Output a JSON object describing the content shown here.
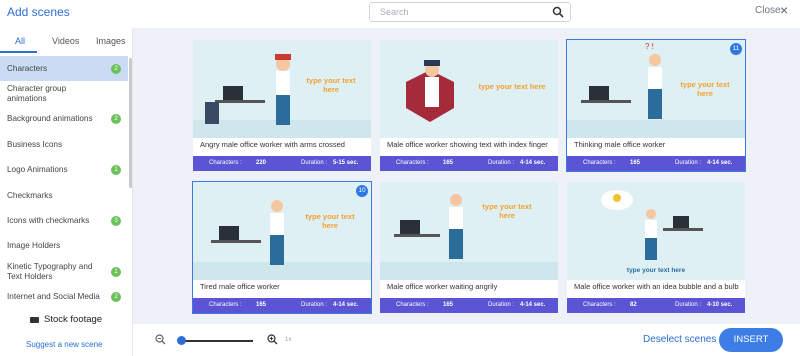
{
  "header": {
    "title": "Add scenes",
    "search_placeholder": "Search",
    "close_label": "Close",
    "close_glyph": "×"
  },
  "sidebar": {
    "tabs": [
      {
        "label": "All"
      },
      {
        "label": "Videos"
      },
      {
        "label": "Images"
      }
    ],
    "categories": [
      {
        "label": "Characters",
        "count": "2"
      },
      {
        "label": "Character group animations",
        "count": ""
      },
      {
        "label": "Background animations",
        "count": "2"
      },
      {
        "label": "Business Icons",
        "count": ""
      },
      {
        "label": "Logo Animations",
        "count": "1"
      },
      {
        "label": "Checkmarks",
        "count": ""
      },
      {
        "label": "Icons with checkmarks",
        "count": "3"
      },
      {
        "label": "Image Holders",
        "count": ""
      },
      {
        "label": "Kinetic Typography and Text Holders",
        "count": "1"
      },
      {
        "label": "Internet and Social Media",
        "count": "2"
      }
    ],
    "stock_footage": "Stock footage",
    "suggest": "Suggest a new scene"
  },
  "scenes": [
    {
      "title": "Angry male office worker with arms crossed",
      "characters_label": "Characters :",
      "characters": "220",
      "duration_label": "Duration :",
      "duration": "5-15 sec.",
      "placeholder": "type your text here",
      "selected": false,
      "badge": ""
    },
    {
      "title": "Male office worker showing text with index finger",
      "characters_label": "Characters :",
      "characters": "165",
      "duration_label": "Duration :",
      "duration": "4-14 sec.",
      "placeholder": "type your text here",
      "selected": false,
      "badge": ""
    },
    {
      "title": "Thinking male office worker",
      "characters_label": "Characters :",
      "characters": "165",
      "duration_label": "Duration :",
      "duration": "4-14 sec.",
      "placeholder": "type your text here",
      "selected": true,
      "badge": "11"
    },
    {
      "title": "Tired male office worker",
      "characters_label": "Characters :",
      "characters": "165",
      "duration_label": "Duration :",
      "duration": "4-14 sec.",
      "placeholder": "type your text here",
      "selected": true,
      "badge": "10"
    },
    {
      "title": "Male office worker waiting angrily",
      "characters_label": "Characters :",
      "characters": "165",
      "duration_label": "Duration :",
      "duration": "4-14 sec.",
      "placeholder": "type your text here",
      "selected": false,
      "badge": ""
    },
    {
      "title": "Male office worker with an idea bubble and a bulb",
      "characters_label": "Characters :",
      "characters": "82",
      "duration_label": "Duration :",
      "duration": "4-10 sec.",
      "placeholder": "type your text here",
      "selected": false,
      "badge": ""
    }
  ],
  "footer": {
    "zoom_level": "1x",
    "deselect_label": "Deselect scenes",
    "insert_label": "INSERT"
  },
  "colors": {
    "accent": "#2b6ed6",
    "info_bar": "#5b55d6",
    "count_badge": "#6ac25a",
    "placeholder_text": "#f3a12f"
  }
}
